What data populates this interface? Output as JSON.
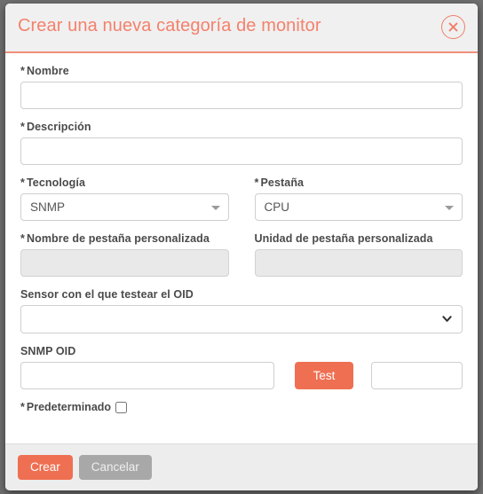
{
  "dialog": {
    "title": "Crear una nueva categoría de monitor",
    "close_icon": "close-circle-icon",
    "required_marker": "*"
  },
  "form": {
    "name": {
      "label": "Nombre",
      "required": true,
      "value": "",
      "placeholder": ""
    },
    "description": {
      "label": "Descripción",
      "required": true,
      "value": "",
      "placeholder": ""
    },
    "technology": {
      "label": "Tecnología",
      "required": true,
      "selected": "SNMP",
      "caret_icon": "caret-down-icon"
    },
    "tab": {
      "label": "Pestaña",
      "required": true,
      "selected": "CPU",
      "caret_icon": "caret-down-icon"
    },
    "custom_tab_name": {
      "label": "Nombre de pestaña personalizada",
      "required": true,
      "value": "",
      "placeholder": "",
      "disabled": true
    },
    "custom_tab_unit": {
      "label": "Unidad de pestaña personalizada",
      "required": false,
      "value": "",
      "placeholder": "",
      "disabled": true
    },
    "sensor": {
      "label": "Sensor con el que testear el OID",
      "required": false,
      "selected": "",
      "chevron_icon": "chevron-down-icon"
    },
    "snmp_oid": {
      "label": "SNMP OID",
      "required": false,
      "value": "",
      "placeholder": ""
    },
    "test_button": {
      "label": "Test"
    },
    "test_result": {
      "value": "",
      "placeholder": ""
    },
    "default_checkbox": {
      "label": "Predeterminado",
      "required": true,
      "checked": false
    }
  },
  "footer": {
    "create_label": "Crear",
    "cancel_label": "Cancelar"
  },
  "colors": {
    "accent": "#ef6f52",
    "title": "#f4816c",
    "header_bg": "#f0f0f0",
    "footer_bg": "#ededed",
    "secondary_button": "#a8a8a8"
  }
}
